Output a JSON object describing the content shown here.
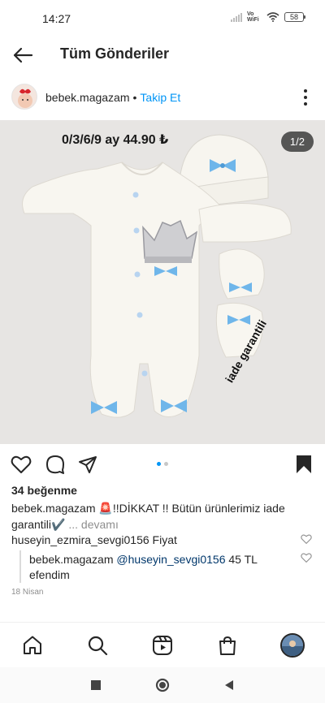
{
  "status_bar": {
    "time": "14:27",
    "network": "Vo WiFi",
    "battery": "58"
  },
  "header": {
    "title": "Tüm Gönderiler"
  },
  "author": {
    "username": "bebek.magazam",
    "separator": "•",
    "follow_label": "Takip Et"
  },
  "post": {
    "price_text": "0/3/6/9 ay 44.90 ₺",
    "counter": "1/2",
    "watermark": "iade garantili",
    "slide_count": 2,
    "active_slide": 1
  },
  "likes": "34 beğenme",
  "caption": {
    "username": "bebek.magazam",
    "text": " 🚨!!DİKKAT !! Bütün ürünlerimiz iade garantili✔️",
    "more": "... devamı"
  },
  "comments": [
    {
      "username": "huseyin_ezmira_sevgi0156",
      "text": " Fiyat"
    },
    {
      "username": "bebek.magazam",
      "mention": "@huseyin_sevgi0156",
      "text": " 45 TL efendim"
    }
  ],
  "date": "18 Nisan",
  "colors": {
    "link": "#0095f6",
    "mention": "#00376b",
    "muted": "#8e8e8e",
    "bow_blue": "#6fb6ea"
  }
}
